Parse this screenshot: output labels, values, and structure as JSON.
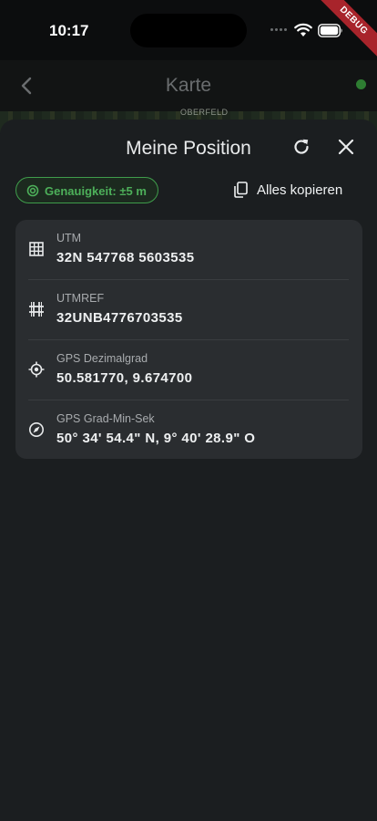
{
  "status_bar": {
    "time": "10:17",
    "debug_label": "DEBUG"
  },
  "app_bar": {
    "title": "Karte",
    "status_color": "#2e7d32"
  },
  "map": {
    "label": "OBERFELD"
  },
  "sheet": {
    "title": "Meine Position",
    "accuracy": "Genauigkeit: ±5 m",
    "copy_all": "Alles kopieren",
    "accent_color": "#4db05a"
  },
  "coordinates": [
    {
      "icon": "grid-icon",
      "label": "UTM",
      "value": "32N 547768 5603535"
    },
    {
      "icon": "hash-grid-icon",
      "label": "UTMREF",
      "value": "32UNB4776703535"
    },
    {
      "icon": "crosshair-icon",
      "label": "GPS Dezimalgrad",
      "value": "50.581770, 9.674700"
    },
    {
      "icon": "compass-icon",
      "label": "GPS Grad-Min-Sek",
      "value": "50° 34' 54.4\" N, 9° 40' 28.9\" O"
    }
  ]
}
